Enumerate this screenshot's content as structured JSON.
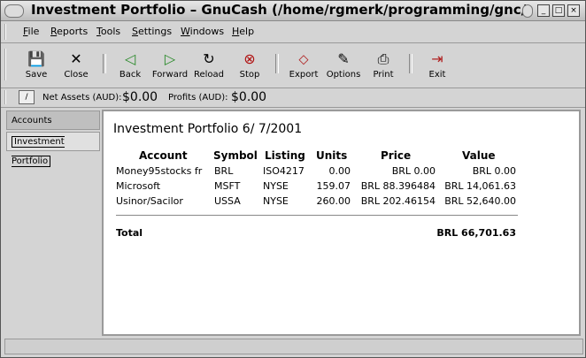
{
  "window": {
    "title": "Investment Portfolio – GnuCash (/home/rgmerk/programming/gnc/gnu",
    "controls": {
      "minimize": "_",
      "maximize": "□",
      "close": "×"
    }
  },
  "menu": {
    "items": [
      {
        "label": "File"
      },
      {
        "label": "Reports"
      },
      {
        "label": "Tools"
      },
      {
        "label": "Settings"
      },
      {
        "label": "Windows"
      },
      {
        "label": "Help"
      }
    ]
  },
  "toolbar": {
    "items": [
      {
        "label": "Save",
        "icon": "floppy-disk-icon",
        "glyph": "💾"
      },
      {
        "label": "Close",
        "icon": "close-x-icon",
        "glyph": "✕"
      },
      {
        "label": "Back",
        "icon": "back-arrow-icon",
        "glyph": "◁"
      },
      {
        "label": "Forward",
        "icon": "forward-arrow-icon",
        "glyph": "▷"
      },
      {
        "label": "Reload",
        "icon": "reload-icon",
        "glyph": "↻"
      },
      {
        "label": "Stop",
        "icon": "stop-icon",
        "glyph": "⊗"
      },
      {
        "label": "Export",
        "icon": "export-icon",
        "glyph": "⬦"
      },
      {
        "label": "Options",
        "icon": "options-icon",
        "glyph": "✎"
      },
      {
        "label": "Print",
        "icon": "printer-icon",
        "glyph": "⎙"
      },
      {
        "label": "Exit",
        "icon": "exit-icon",
        "glyph": "⇥"
      }
    ]
  },
  "summary": {
    "button": "/",
    "net_assets_label": "Net Assets (AUD):",
    "net_assets_value": "$0.00",
    "profits_label": "Profits (AUD):",
    "profits_value": "$0.00"
  },
  "tabs": [
    {
      "label": "Accounts"
    },
    {
      "label": "Investment Portfolio"
    }
  ],
  "report": {
    "title": "Investment Portfolio 6/ 7/2001",
    "columns": [
      "Account",
      "Symbol",
      "Listing",
      "Units",
      "Price",
      "Value"
    ],
    "rows": [
      {
        "account": "Money95stocks fr",
        "symbol": "BRL",
        "listing": "ISO4217",
        "units": "0.00",
        "price": "BRL 0.00",
        "value": "BRL 0.00"
      },
      {
        "account": "Microsoft",
        "symbol": "MSFT",
        "listing": "NYSE",
        "units": "159.07",
        "price": "BRL 88.396484",
        "value": "BRL 14,061.63"
      },
      {
        "account": "Usinor/Sacilor",
        "symbol": "USSA",
        "listing": "NYSE",
        "units": "260.00",
        "price": "BRL 202.46154",
        "value": "BRL 52,640.00"
      }
    ],
    "total_label": "Total",
    "total_value": "BRL 66,701.63"
  }
}
